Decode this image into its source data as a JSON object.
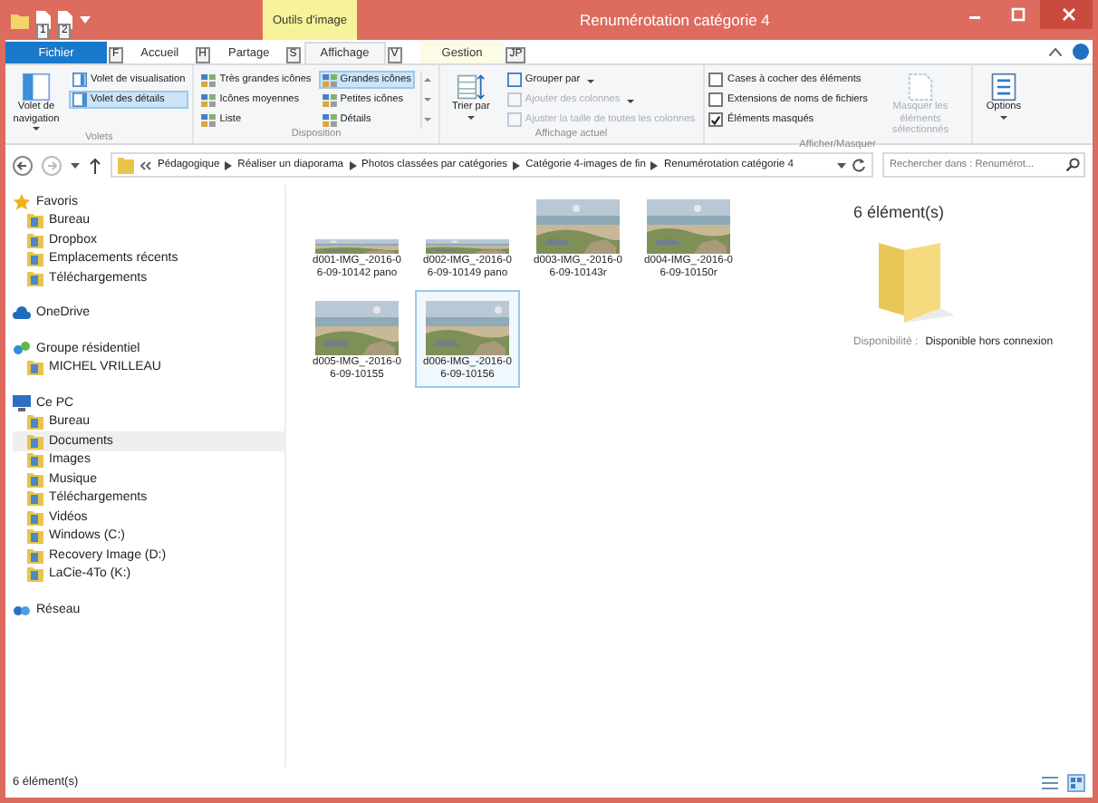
{
  "window": {
    "title": "Renumérotation catégorie 4",
    "contextual_tab": "Outils d'image",
    "quick_access_keytips": [
      "1",
      "2"
    ]
  },
  "tabs": [
    {
      "label": "Fichier",
      "keytip": "F",
      "kind": "file",
      "selected": false
    },
    {
      "label": "Accueil",
      "keytip": "H",
      "kind": "tab",
      "selected": false
    },
    {
      "label": "Partage",
      "keytip": "S",
      "kind": "tab",
      "selected": false
    },
    {
      "label": "Affichage",
      "keytip": "V",
      "kind": "tab",
      "selected": true
    },
    {
      "label": "Gestion",
      "keytip": "JP",
      "kind": "contextual",
      "selected": false
    }
  ],
  "ribbon": {
    "volets": {
      "label": "Volets",
      "big": "Volet de navigation",
      "items": [
        {
          "label": "Volet de visualisation",
          "selected": false
        },
        {
          "label": "Volet des détails",
          "selected": true
        }
      ]
    },
    "disposition": {
      "label": "Disposition",
      "options": [
        {
          "label": "Très grandes icônes",
          "selected": false
        },
        {
          "label": "Grandes icônes",
          "selected": true
        },
        {
          "label": "Icônes moyennes",
          "selected": false
        },
        {
          "label": "Petites icônes",
          "selected": false
        },
        {
          "label": "Liste",
          "selected": false
        },
        {
          "label": "Détails",
          "selected": false
        }
      ]
    },
    "affichage_actuel": {
      "label": "Affichage actuel",
      "big": "Trier par",
      "items": [
        {
          "label": "Grouper par",
          "disabled": false
        },
        {
          "label": "Ajouter des colonnes",
          "disabled": true
        },
        {
          "label": "Ajuster la taille de toutes les colonnes",
          "disabled": true
        }
      ]
    },
    "afficher_masquer": {
      "label": "Afficher/Masquer",
      "checkboxes": [
        {
          "label": "Cases à cocher des éléments",
          "checked": false
        },
        {
          "label": "Extensions de noms de fichiers",
          "checked": false
        },
        {
          "label": "Éléments masqués",
          "checked": true
        }
      ],
      "big": {
        "label": "Masquer les éléments sélectionnés",
        "disabled": true
      }
    },
    "options": {
      "label": "Options"
    }
  },
  "address": {
    "path": [
      "Pédagogique",
      "Réaliser un diaporama",
      "Photos classées par catégories",
      "Catégorie 4-images de fin",
      "Renumérotation catégorie 4"
    ],
    "search_placeholder": "Rechercher dans : Renumérot..."
  },
  "navigation": [
    {
      "label": "Favoris",
      "selected": false,
      "children": [
        {
          "label": "Bureau",
          "selected": false
        },
        {
          "label": "Dropbox",
          "selected": false
        },
        {
          "label": "Emplacements récents",
          "selected": false
        },
        {
          "label": "Téléchargements",
          "selected": false
        }
      ]
    },
    {
      "label": "OneDrive",
      "selected": false
    },
    {
      "label": "Groupe résidentiel",
      "selected": false,
      "children": [
        {
          "label": "MICHEL VRILLEAU",
          "selected": false
        }
      ]
    },
    {
      "label": "Ce PC",
      "selected": false,
      "children": [
        {
          "label": "Bureau",
          "selected": false
        },
        {
          "label": "Documents",
          "selected": true
        },
        {
          "label": "Images",
          "selected": false
        },
        {
          "label": "Musique",
          "selected": false
        },
        {
          "label": "Téléchargements",
          "selected": false
        },
        {
          "label": "Vidéos",
          "selected": false
        },
        {
          "label": "Windows (C:)",
          "selected": false
        },
        {
          "label": "Recovery Image (D:)",
          "selected": false
        },
        {
          "label": "LaCie-4To (K:)",
          "selected": false
        }
      ]
    },
    {
      "label": "Réseau",
      "selected": false
    }
  ],
  "files": [
    {
      "name": "d001-IMG_-2016-06-09-10142 pano",
      "kind": "pano",
      "selected": false
    },
    {
      "name": "d002-IMG_-2016-06-09-10149 pano",
      "kind": "pano",
      "selected": false
    },
    {
      "name": "d003-IMG_-2016-06-09-10143r",
      "selected": false
    },
    {
      "name": "d004-IMG_-2016-06-09-10150r",
      "selected": false
    },
    {
      "name": "d005-IMG_-2016-06-09-10155",
      "selected": false
    },
    {
      "name": "d006-IMG_-2016-06-09-10156",
      "selected": true
    }
  ],
  "details": {
    "count": "6 élément(s)",
    "availability_label": "Disponibilité :",
    "availability_value": "Disponible hors connexion"
  },
  "status_bar": {
    "count": "6 élément(s)"
  }
}
